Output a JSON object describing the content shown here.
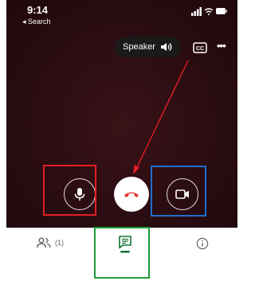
{
  "status_bar": {
    "time": "9:14",
    "back_label": "◂ Search"
  },
  "call_controls": {
    "speaker_label": "Speaker",
    "cc_label": "CC",
    "more_label": "•••"
  },
  "bottom_tabs": {
    "people_count": "(1)"
  },
  "colors": {
    "end_call_red": "#e53935",
    "chat_tab_green": "#137333",
    "highlight_red": "#e31e25",
    "highlight_blue": "#1f6fd1",
    "highlight_green": "#1e9e3a"
  },
  "icons": [
    "signal-icon",
    "wifi-icon",
    "battery-icon",
    "speaker-icon",
    "closed-captions-icon",
    "more-options-icon",
    "microphone-icon",
    "end-call-icon",
    "video-camera-icon",
    "people-icon",
    "chat-icon",
    "info-icon"
  ]
}
